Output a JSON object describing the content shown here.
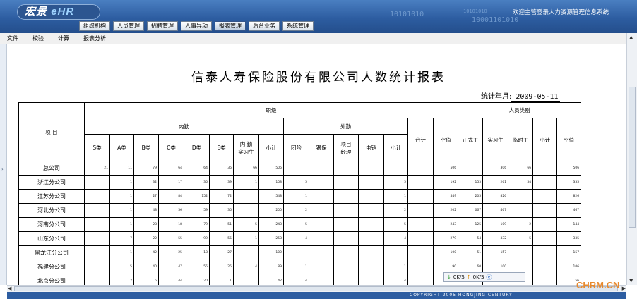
{
  "header": {
    "logo_text": "宏景",
    "logo_suffix": "eHR",
    "binary_1": "10101010",
    "binary_2": "10101010",
    "binary_3": "10001101010",
    "welcome": "欢迎主管登录人力资源管理信息系统"
  },
  "nav": [
    {
      "label": "组织机构"
    },
    {
      "label": "人员管理"
    },
    {
      "label": "招聘管理"
    },
    {
      "label": "人事异动"
    },
    {
      "label": "报表管理"
    },
    {
      "label": "后台业务"
    },
    {
      "label": "系统管理"
    }
  ],
  "toolbar": [
    {
      "label": "文件"
    },
    {
      "label": "校验"
    },
    {
      "label": "计算"
    },
    {
      "label": "报表分析"
    }
  ],
  "report": {
    "title": "信泰人寿保险股份有限公司人数统计报表",
    "date_label": "统计年月:",
    "date_value": "2009-05-11",
    "headers": {
      "item": "项 目",
      "grade": "职级",
      "category": "人员类别",
      "internal": "内勤",
      "external": "外勤",
      "total": "合计",
      "vacancy": "空值",
      "s": "S类",
      "a": "A类",
      "b": "B类",
      "c": "C类",
      "d": "D类",
      "e": "E类",
      "intern_internal": "内 勤\n实习生",
      "subtotal": "小计",
      "team": "团险",
      "bank": "银保",
      "project_manager": "项目\n经理",
      "telesales": "电销",
      "formal": "正式工",
      "intern": "实习生",
      "temp": "临时工"
    },
    "rows": [
      {
        "name": "总公司",
        "cells": [
          "21",
          "11",
          "79",
          "64",
          "64",
          "36",
          "66",
          "506",
          "",
          "",
          "",
          "",
          "",
          "",
          "506",
          "",
          "306",
          "66",
          "",
          "506",
          ""
        ]
      },
      {
        "name": "浙江分公司",
        "cells": [
          "",
          "1",
          "32",
          "17",
          "35",
          "39",
          "1",
          "158",
          "5",
          "",
          "",
          "",
          "5",
          "",
          "192",
          "153",
          "261",
          "54",
          "",
          "335",
          ""
        ]
      },
      {
        "name": "江苏分公司",
        "cells": [
          "",
          "1",
          "27",
          "84",
          "152",
          "72",
          "",
          "548",
          "1",
          "",
          "",
          "",
          "1",
          "",
          "549",
          "205",
          "826",
          "",
          "",
          "826",
          "5"
        ]
      },
      {
        "name": "河北分公司",
        "cells": [
          "",
          "1",
          "48",
          "56",
          "59",
          "35",
          "",
          "200",
          "2",
          "",
          "",
          "",
          "2",
          "",
          "202",
          "067",
          "467",
          "",
          "",
          "467",
          ""
        ]
      },
      {
        "name": "河南分公司",
        "cells": [
          "",
          "1",
          "28",
          "18",
          "79",
          "51",
          "5",
          "243",
          "5",
          "",
          "",
          "",
          "5",
          "",
          "243",
          "125",
          "109",
          "2",
          "",
          "144",
          ""
        ]
      },
      {
        "name": "山东分公司",
        "cells": [
          "",
          "7",
          "22",
          "55",
          "99",
          "55",
          "1",
          "258",
          "4",
          "",
          "",
          "",
          "4",
          "",
          "279",
          "54",
          "332",
          "5",
          "",
          "335",
          ""
        ]
      },
      {
        "name": "黑龙江分公司",
        "cells": [
          "",
          "1",
          "42",
          "25",
          "18",
          "27",
          "",
          "100",
          "",
          "",
          "",
          "",
          "",
          "",
          "100",
          "51",
          "157",
          "",
          "",
          "157",
          ""
        ]
      },
      {
        "name": "福建分公司",
        "cells": [
          "",
          "5",
          "40",
          "47",
          "55",
          "25",
          "4",
          "89",
          "1",
          "",
          "",
          "",
          "1",
          "",
          "90",
          "60",
          "100",
          "",
          "",
          "106",
          ""
        ]
      },
      {
        "name": "北京分公司",
        "cells": [
          "",
          "2",
          "5",
          "44",
          "20",
          "1",
          "",
          "42",
          "4",
          "",
          "",
          "",
          "4",
          "",
          "43",
          "",
          "56",
          "",
          "",
          "56",
          ""
        ]
      }
    ]
  },
  "speed_widget": {
    "down": "0K/S",
    "up": "0K/S"
  },
  "footer": {
    "copyright": "COPYRIGHT 2005 HONGJING CENTURY"
  },
  "watermark": "CHRM.CN"
}
